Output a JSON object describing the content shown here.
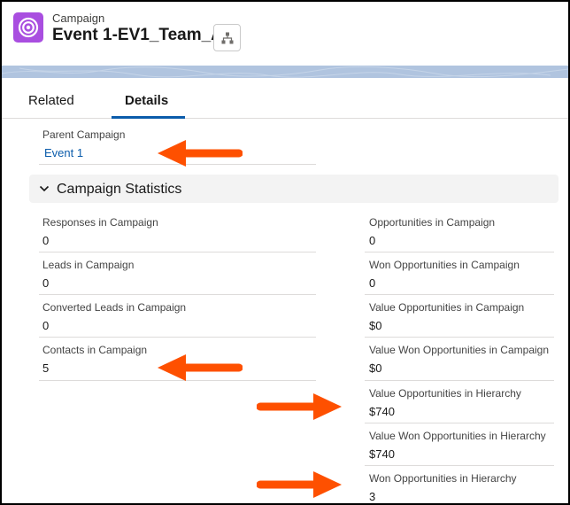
{
  "header": {
    "object_label": "Campaign",
    "record_name": "Event 1-EV1_Team_A"
  },
  "tabs": [
    {
      "label": "Related",
      "active": false
    },
    {
      "label": "Details",
      "active": true
    }
  ],
  "parent_campaign": {
    "label": "Parent Campaign",
    "value": "Event 1"
  },
  "section": {
    "title": "Campaign Statistics"
  },
  "left_fields": [
    {
      "label": "Responses in Campaign",
      "value": "0"
    },
    {
      "label": "Leads in Campaign",
      "value": "0"
    },
    {
      "label": "Converted Leads in Campaign",
      "value": "0"
    },
    {
      "label": "Contacts in Campaign",
      "value": "5"
    }
  ],
  "right_fields": [
    {
      "label": "Opportunities in Campaign",
      "value": "0"
    },
    {
      "label": "Won Opportunities in Campaign",
      "value": "0"
    },
    {
      "label": "Value Opportunities in Campaign",
      "value": "$0"
    },
    {
      "label": "Value Won Opportunities in Campaign",
      "value": "$0"
    },
    {
      "label": "Value Opportunities in Hierarchy",
      "value": "$740"
    },
    {
      "label": "Value Won Opportunities in Hierarchy",
      "value": "$740"
    },
    {
      "label": "Won Opportunities in Hierarchy",
      "value": "3"
    }
  ],
  "colors": {
    "app_icon": "#a94ee0",
    "link": "#0b5cab",
    "annotation_arrow": "#fe5000"
  },
  "icons": {
    "app": "campaign-target-icon",
    "hierarchy": "hierarchy-icon",
    "section": "chevron-down-icon",
    "annotation": "arrow-icon"
  }
}
